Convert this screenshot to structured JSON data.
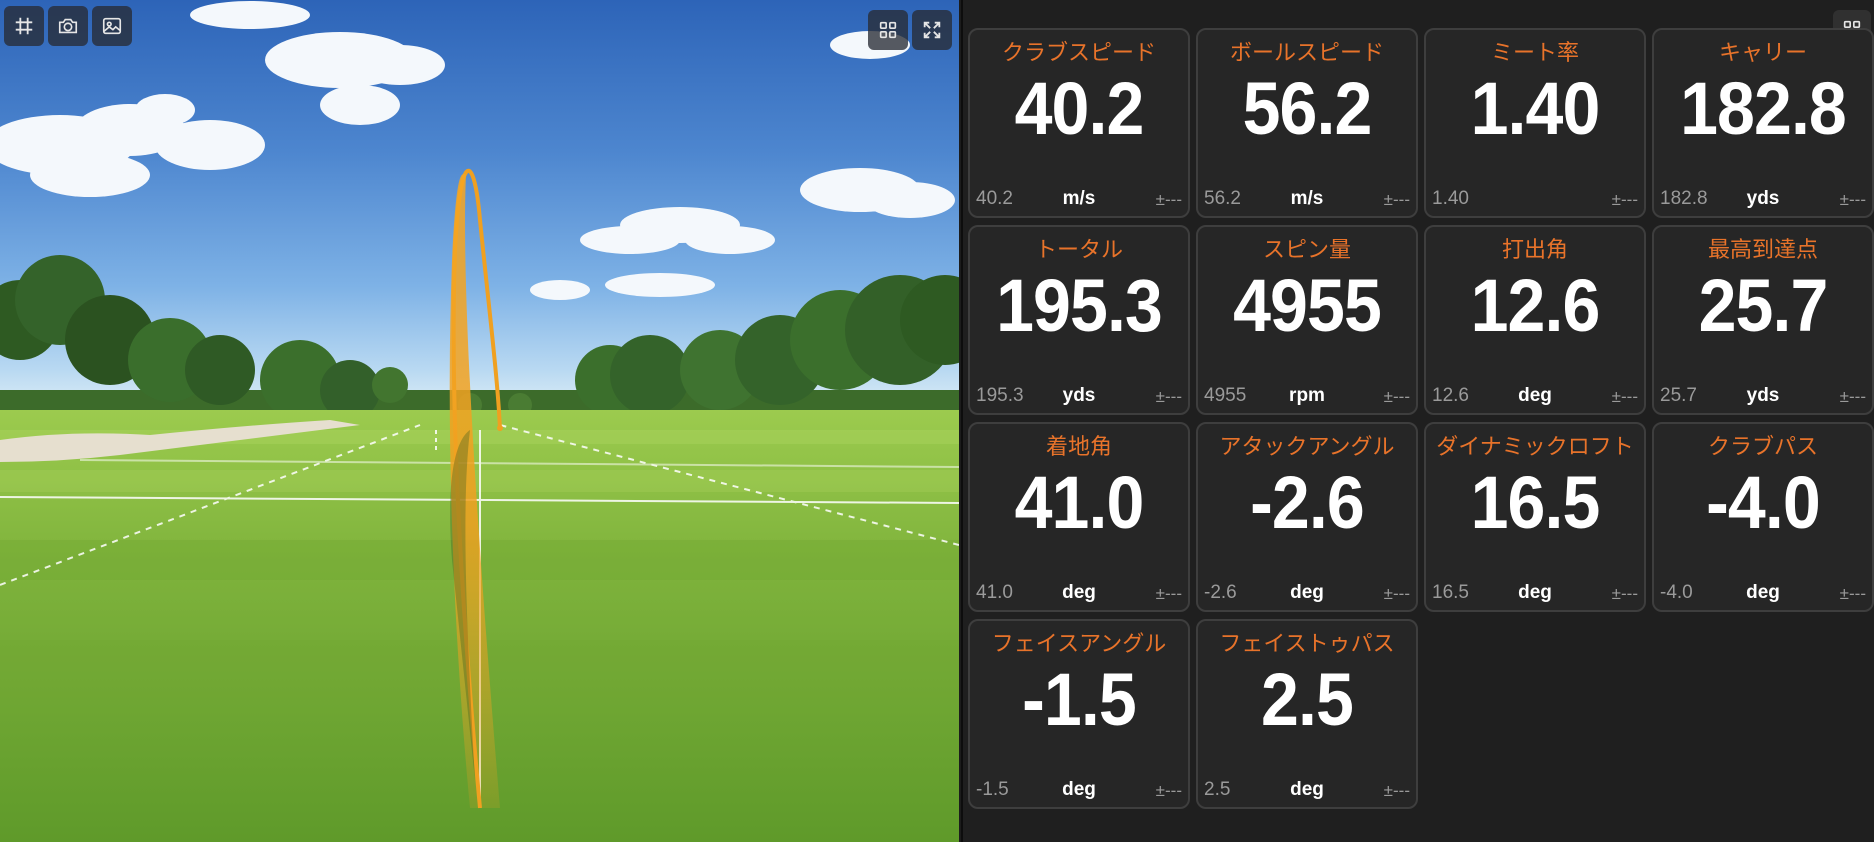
{
  "toolbar_left": [
    {
      "name": "grid-toggle-button",
      "icon": "hash-icon"
    },
    {
      "name": "screenshot-button",
      "icon": "camera-icon"
    },
    {
      "name": "image-button",
      "icon": "image-icon"
    }
  ],
  "view_controls": [
    {
      "name": "layout-button",
      "icon": "layout-grid-icon"
    },
    {
      "name": "fullscreen-button",
      "icon": "expand-icon"
    }
  ],
  "panel_controls": [
    {
      "name": "panel-layout-button",
      "icon": "layout-grid-icon"
    }
  ],
  "colors": {
    "label": "#e8732a",
    "value": "#ffffff",
    "card_bg": "#262626",
    "trajectory": "#f2a21c"
  },
  "metrics": [
    {
      "label": "クラブスピード",
      "value": "40.2",
      "sub": "40.2",
      "unit": "m/s",
      "tolerance": "±---"
    },
    {
      "label": "ボールスピード",
      "value": "56.2",
      "sub": "56.2",
      "unit": "m/s",
      "tolerance": "±---"
    },
    {
      "label": "ミート率",
      "value": "1.40",
      "sub": "1.40",
      "unit": "",
      "tolerance": "±---"
    },
    {
      "label": "キャリー",
      "value": "182.8",
      "sub": "182.8",
      "unit": "yds",
      "tolerance": "±---"
    },
    {
      "label": "トータル",
      "value": "195.3",
      "sub": "195.3",
      "unit": "yds",
      "tolerance": "±---"
    },
    {
      "label": "スピン量",
      "value": "4955",
      "sub": "4955",
      "unit": "rpm",
      "tolerance": "±---"
    },
    {
      "label": "打出角",
      "value": "12.6",
      "sub": "12.6",
      "unit": "deg",
      "tolerance": "±---"
    },
    {
      "label": "最高到達点",
      "value": "25.7",
      "sub": "25.7",
      "unit": "yds",
      "tolerance": "±---"
    },
    {
      "label": "着地角",
      "value": "41.0",
      "sub": "41.0",
      "unit": "deg",
      "tolerance": "±---"
    },
    {
      "label": "アタックアングル",
      "value": "-2.6",
      "sub": "-2.6",
      "unit": "deg",
      "tolerance": "±---"
    },
    {
      "label": "ダイナミックロフト",
      "value": "16.5",
      "sub": "16.5",
      "unit": "deg",
      "tolerance": "±---"
    },
    {
      "label": "クラブパス",
      "value": "-4.0",
      "sub": "-4.0",
      "unit": "deg",
      "tolerance": "±---"
    },
    {
      "label": "フェイスアングル",
      "value": "-1.5",
      "sub": "-1.5",
      "unit": "deg",
      "tolerance": "±---"
    },
    {
      "label": "フェイストゥパス",
      "value": "2.5",
      "sub": "2.5",
      "unit": "deg",
      "tolerance": "±---"
    }
  ]
}
